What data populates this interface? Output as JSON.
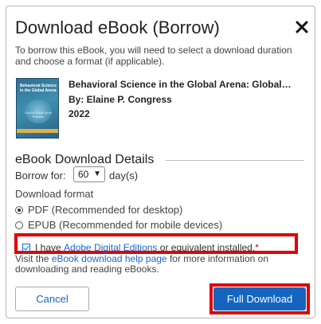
{
  "dialog": {
    "title": "Download eBook (Borrow)",
    "intro": "To borrow this eBook, you will need to select a download duration and choose a format (if applicable)."
  },
  "book": {
    "title": "Behavioral Science in the Global Arena: Global…",
    "author": "By: Elaine P. Congress",
    "year": "2022",
    "cover_title": "Behavioral Science in the Global Arena",
    "cover_subtitle": "Global Social Work Practice"
  },
  "details": {
    "heading": "eBook Download Details",
    "borrow_label": "Borrow for:",
    "borrow_value": "60",
    "borrow_unit": "day(s)",
    "format_label": "Download format",
    "formats": [
      {
        "label": "PDF (Recommended for desktop)",
        "selected": true
      },
      {
        "label": "EPUB (Recommended for mobile devices)",
        "selected": false
      }
    ]
  },
  "consent": {
    "prefix": "I have ",
    "link": "Adobe Digital Editions",
    "suffix": " or equivalent installed.",
    "required_mark": "*",
    "checked": true
  },
  "help": {
    "prefix": "Visit the ",
    "link": "eBook download help page",
    "suffix": " for more information on downloading and reading eBooks."
  },
  "buttons": {
    "cancel": "Cancel",
    "download": "Full Download"
  },
  "colors": {
    "accent": "#1565c0",
    "link": "#1a66c9",
    "highlight": "#e00000"
  },
  "icons": {
    "close": "close-icon",
    "dropdown": "chevron-down-icon"
  }
}
